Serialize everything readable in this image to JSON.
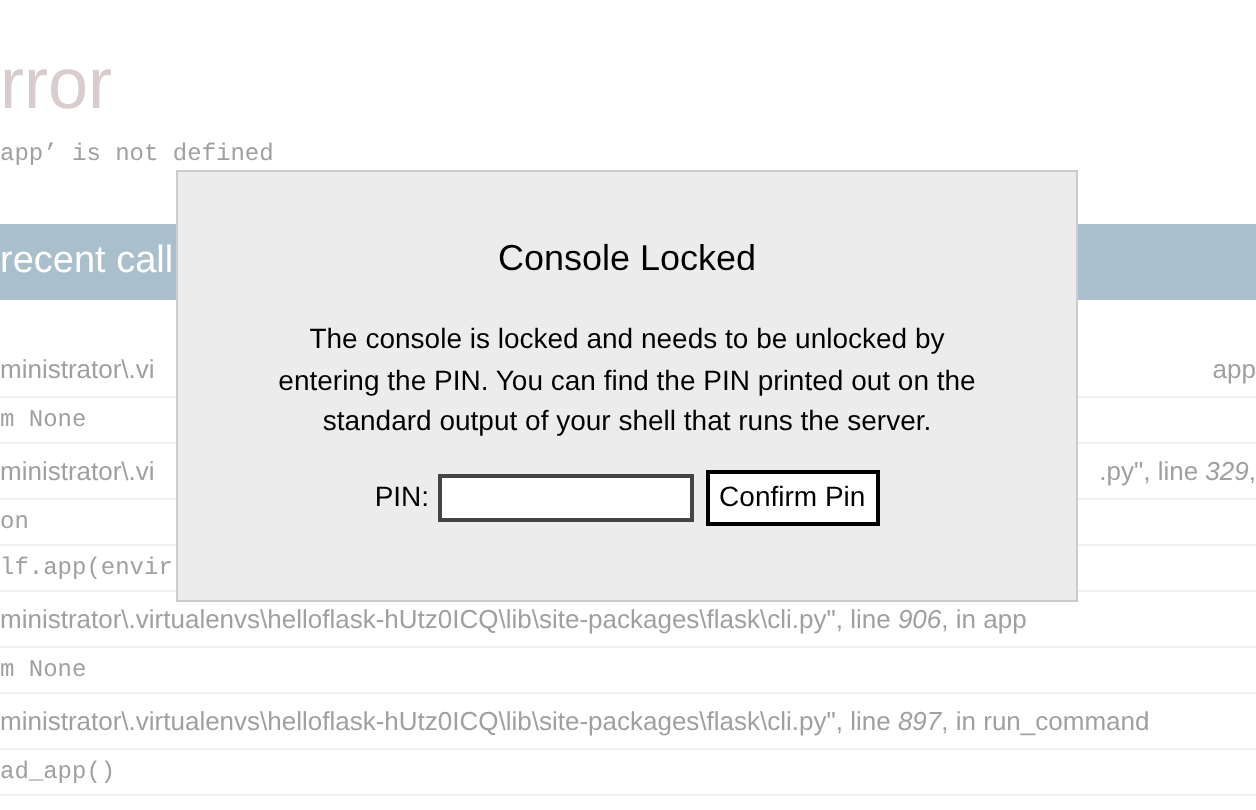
{
  "page": {
    "title": "rror",
    "message": "app’ is not defined",
    "traceback_header": "recent call"
  },
  "traceback_rows": [
    {
      "kind": "file",
      "left": "ministrator\\.vi",
      "right": "app"
    },
    {
      "kind": "code",
      "left": "m None"
    },
    {
      "kind": "file",
      "left": "ministrator\\.vi",
      "right": ".py\", line *329*,"
    },
    {
      "kind": "code",
      "left": "on"
    },
    {
      "kind": "code",
      "left": "lf.app(envir"
    },
    {
      "kind": "file",
      "left": "ministrator\\.virtualenvs\\helloflask-hUtz0ICQ\\lib\\site-packages\\flask\\cli.py\", line *906*, in app"
    },
    {
      "kind": "code",
      "left": "m None"
    },
    {
      "kind": "file",
      "left": "ministrator\\.virtualenvs\\helloflask-hUtz0ICQ\\lib\\site-packages\\flask\\cli.py\", line *897*, in run_command"
    },
    {
      "kind": "code",
      "left": "ad_app()"
    }
  ],
  "dialog": {
    "title": "Console Locked",
    "message": "The console is locked and needs to be unlocked by entering the PIN. You can find the PIN printed out on the standard output of your shell that runs the server.",
    "pin_label": "PIN:",
    "button": "Confirm Pin"
  }
}
